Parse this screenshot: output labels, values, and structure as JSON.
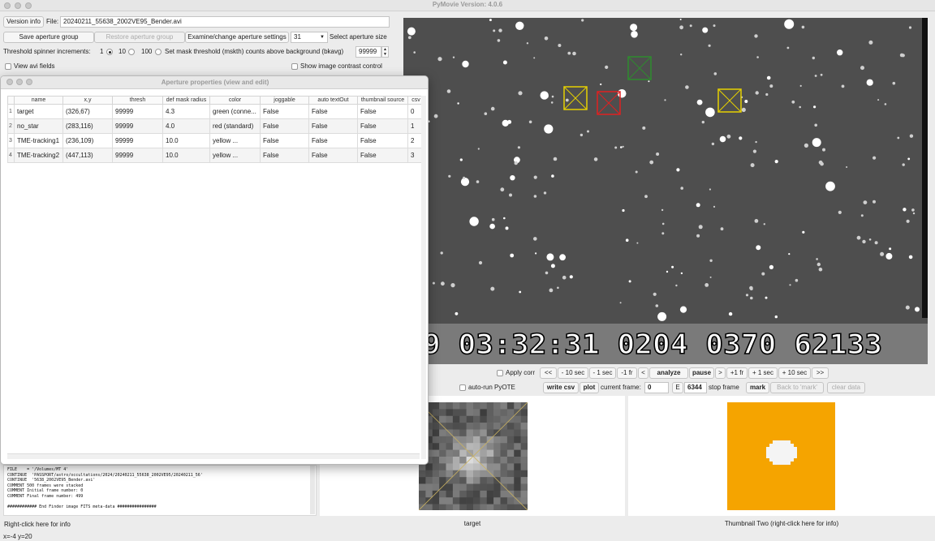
{
  "window": {
    "title": "PyMovie  Version: 4.0.6"
  },
  "top": {
    "version_info_label": "Version info",
    "file_label": "File:",
    "file_value": "20240211_55638_2002VE95_Bender.avi",
    "save_aperture_group": "Save aperture group",
    "restore_aperture_group": "Restore aperture group",
    "examine_aperture_settings": "Examine/change aperture settings",
    "aperture_size_value": "31",
    "select_aperture_size_label": "Select aperture size",
    "threshold_spinner_label": "Threshold spinner increments:",
    "increment_options": [
      "1",
      "10",
      "100"
    ],
    "increment_selected": "1",
    "set_mask_threshold_label": "Set mask threshold (mskth) counts above background (bkavg)",
    "mask_threshold_value": "99999",
    "view_avi_fields_label": "View avi fields",
    "show_contrast_label": "Show image contrast control"
  },
  "dialog": {
    "title": "Aperture properties (view and edit)",
    "columns": [
      "name",
      "x,y",
      "thresh",
      "def mask radius",
      "color",
      "joggable",
      "auto textOut",
      "thumbnail source",
      "csv"
    ],
    "rows": [
      {
        "num": "1",
        "cells": [
          "target",
          "(326,67)",
          "99999",
          "4.3",
          "green (conne...",
          "False",
          "False",
          "False",
          "0"
        ]
      },
      {
        "num": "2",
        "cells": [
          "no_star",
          "(283,116)",
          "99999",
          "4.0",
          "red (standard)",
          "False",
          "False",
          "False",
          "1"
        ]
      },
      {
        "num": "3",
        "cells": [
          "TME-tracking1",
          "(236,109)",
          "99999",
          "10.0",
          "yellow ...",
          "False",
          "False",
          "False",
          "2"
        ]
      },
      {
        "num": "4",
        "cells": [
          "TME-tracking2",
          "(447,113)",
          "99999",
          "10.0",
          "yellow ...",
          "False",
          "False",
          "False",
          "3"
        ]
      }
    ]
  },
  "log_lines": [
    "FILE    = '/Volumes/MT 4'",
    "CONTINUE  'PASSPORT/astro/occultations/2024/20240211_55638_2002VE95/20240211_56'",
    "CONTINUE  '5638_2002VE95_Bender.avi'",
    "COMMENT 500 frames were stacked",
    "COMMENT Initial frame number: 0",
    "COMMENT Final frame number: 499",
    "",
    "############ End Finder image FITS meta-data ################"
  ],
  "timestamp_overlay": "9 03:32:31 0204 0370 62133",
  "controls": {
    "apply_corr": "Apply corr",
    "auto_run_pyote": "auto-run PyOTE",
    "nav_buttons": [
      "<<",
      "- 10 sec",
      "- 1 sec",
      "-1 fr",
      "<",
      "analyze",
      "pause",
      ">",
      "+1 fr",
      "+ 1 sec",
      "+ 10 sec",
      ">>"
    ],
    "write_csv": "write csv",
    "plot": "plot",
    "current_frame_label": "current frame:",
    "current_frame_value": "0",
    "e_label": "E",
    "stop_frame_value": "6344",
    "stop_frame_label": "stop frame",
    "mark": "mark",
    "back_to_mark": "Back to 'mark'",
    "clear_data": "clear data"
  },
  "bottom": {
    "right_click_info": "Right-click here for info",
    "thumb_one_caption": "target",
    "thumb_two_caption": "Thumbnail Two (right-click here for info)",
    "cursor_readout": "x=-4 y=20"
  },
  "colors": {
    "thumb_two_background": "#f5a400",
    "aperture_green": "#2e8b2e",
    "aperture_red": "#e02020",
    "aperture_yellow": "#e6d000"
  }
}
